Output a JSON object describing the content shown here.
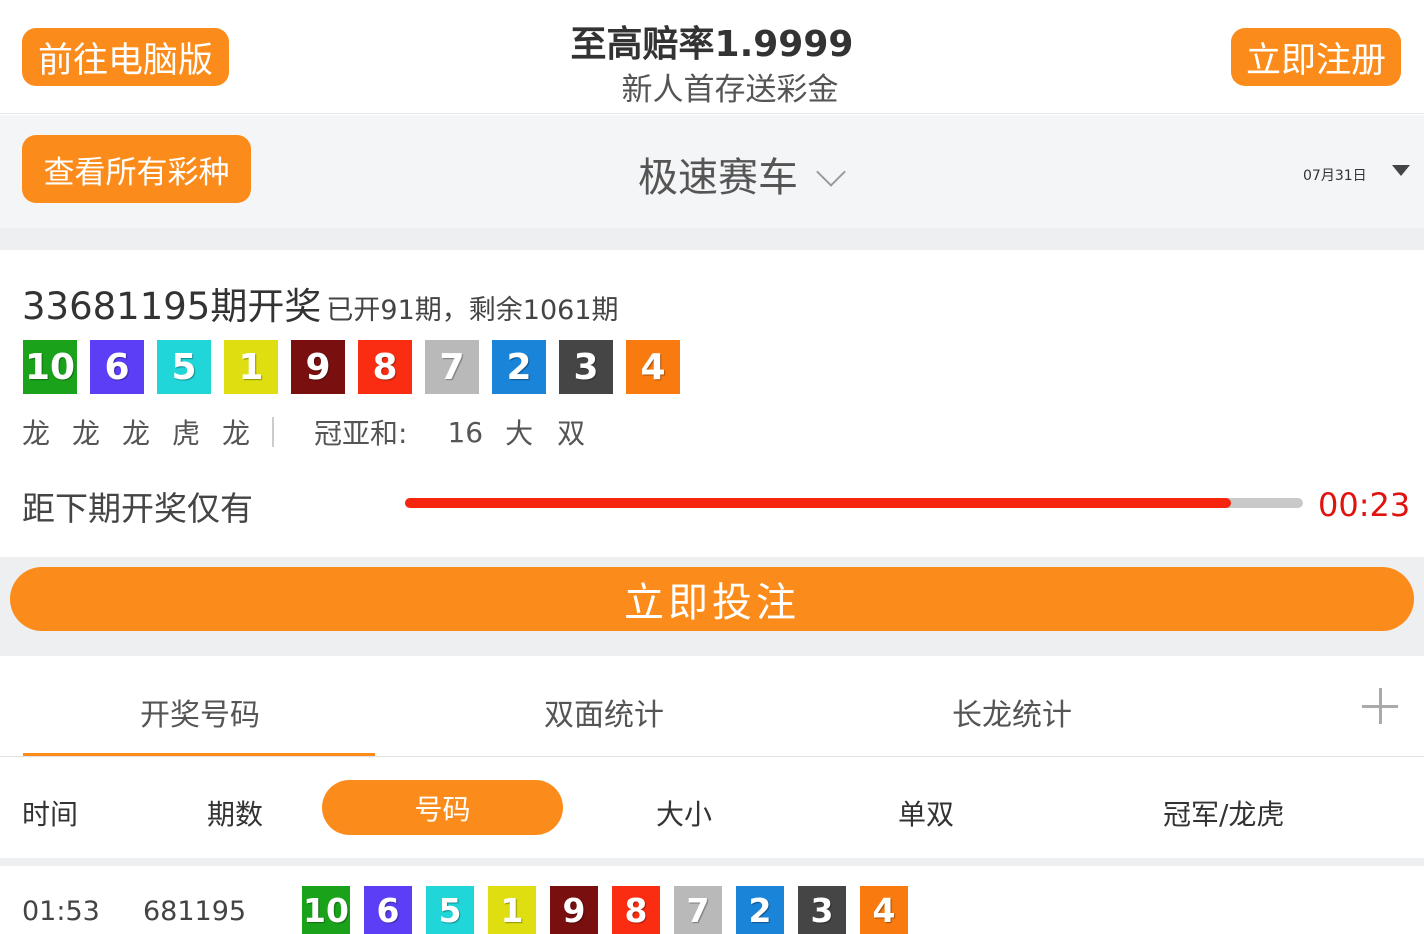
{
  "header": {
    "pc_button": "前往电脑版",
    "promo_title": "至高赔率1.9999",
    "promo_subtitle": "新人首存送彩金",
    "register_button": "立即注册"
  },
  "selector": {
    "all_lotteries_button": "查看所有彩种",
    "game_name": "极速赛车",
    "date": "07月31日"
  },
  "latest": {
    "issue_title": "33681195期开奖",
    "issue_progress": "已开91期，剩余1061期",
    "balls": [
      {
        "n": "10",
        "color": "#1aa31a"
      },
      {
        "n": "6",
        "color": "#5b3ef5"
      },
      {
        "n": "5",
        "color": "#21d6d9"
      },
      {
        "n": "1",
        "color": "#dede10"
      },
      {
        "n": "9",
        "color": "#7a0f0f"
      },
      {
        "n": "8",
        "color": "#fa2d12"
      },
      {
        "n": "7",
        "color": "#b9b9b9"
      },
      {
        "n": "2",
        "color": "#1a84d8"
      },
      {
        "n": "3",
        "color": "#454545"
      },
      {
        "n": "4",
        "color": "#f97a0e"
      }
    ],
    "dragon_tiger": [
      "龙",
      "龙",
      "龙",
      "虎",
      "龙"
    ],
    "sum_label": "冠亚和:",
    "sum_value": "16",
    "sum_size": "大",
    "sum_parity": "双",
    "countdown_label": "距下期开奖仅有",
    "countdown_time": "00:23",
    "countdown_progress": 0.92
  },
  "bet_button": "立即投注",
  "tabs": {
    "items": [
      "开奖号码",
      "双面统计",
      "长龙统计"
    ],
    "active": 0
  },
  "filters": {
    "time": "时间",
    "issue": "期数",
    "number": "号码",
    "size": "大小",
    "parity": "单双",
    "champion": "冠军/龙虎"
  },
  "rows": [
    {
      "time": "01:53",
      "issue": "681195",
      "balls": [
        "10",
        "6",
        "5",
        "1",
        "9",
        "8",
        "7",
        "2",
        "3",
        "4"
      ]
    }
  ],
  "colors": {
    "accent": "#fb8c1b",
    "countdown_bar": "#f5260d",
    "countdown_text": "#e0130f"
  }
}
